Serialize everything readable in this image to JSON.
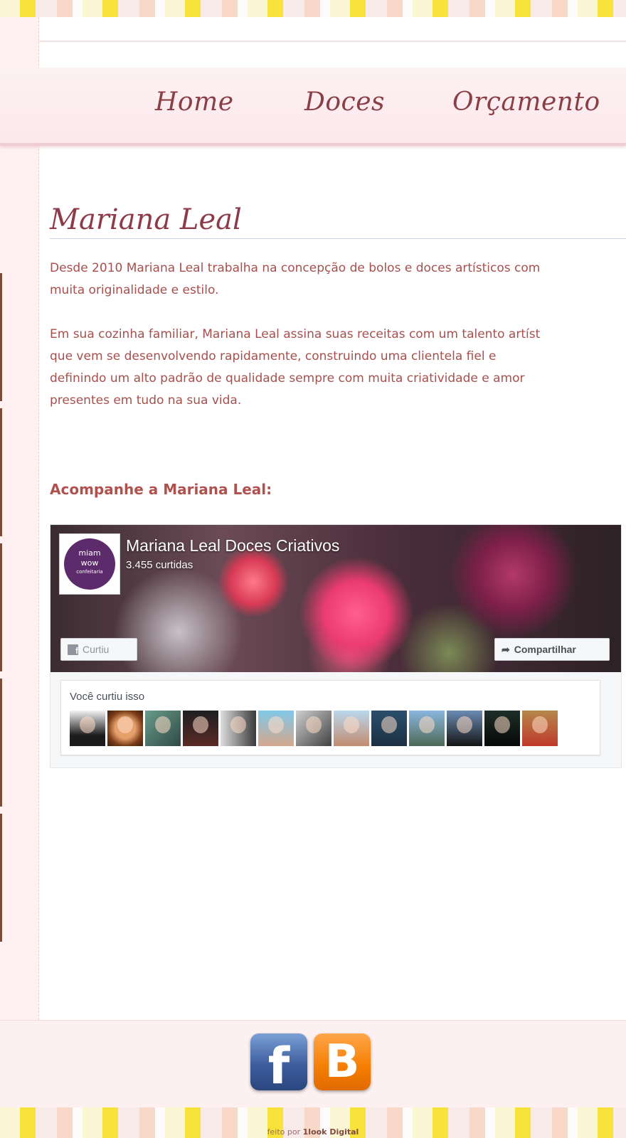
{
  "nav": {
    "items": [
      "Home",
      "Doces",
      "Orçamento"
    ]
  },
  "main": {
    "title": "Mariana Leal",
    "paragraph_1": {
      "line_1": "Desde 2010 Mariana Leal trabalha na concepção de bolos e doces artísticos com",
      "line_2": "muita originalidade e estilo."
    },
    "paragraph_2": {
      "line_1": "Em sua cozinha familiar, Mariana Leal assina suas receitas com um talento artíst",
      "line_2": "que vem se desenvolvendo rapidamente, construindo uma clientela fiel e",
      "line_3": "definindo um alto padrão de qualidade sempre com muita criatividade e amor",
      "line_4": "presentes em tudo na sua vida."
    },
    "follow_heading": "Acompanhe a Mariana Leal:"
  },
  "facebook_widget": {
    "page_name": "Mariana Leal Doces Criativos",
    "likes": "3.455 curtidas",
    "like_button": "Curtiu",
    "share_button": "Compartilhar",
    "liked_text": "Você curtiu isso",
    "logo_text": [
      "miam",
      "wow",
      "confeitaria"
    ],
    "friend_avatar_count": 13
  },
  "footer": {
    "social_icons": [
      "facebook-icon",
      "blogger-icon"
    ],
    "credit_prefix": "feito por",
    "credit_brand": "1look Digital"
  },
  "colors": {
    "nav_text": "#8a3e45",
    "title": "#8e3b49",
    "body_text": "#a6504d",
    "heading": "#b0514e",
    "facebook_blue": "#3d5d9e",
    "blogger_orange": "#f57d00"
  }
}
